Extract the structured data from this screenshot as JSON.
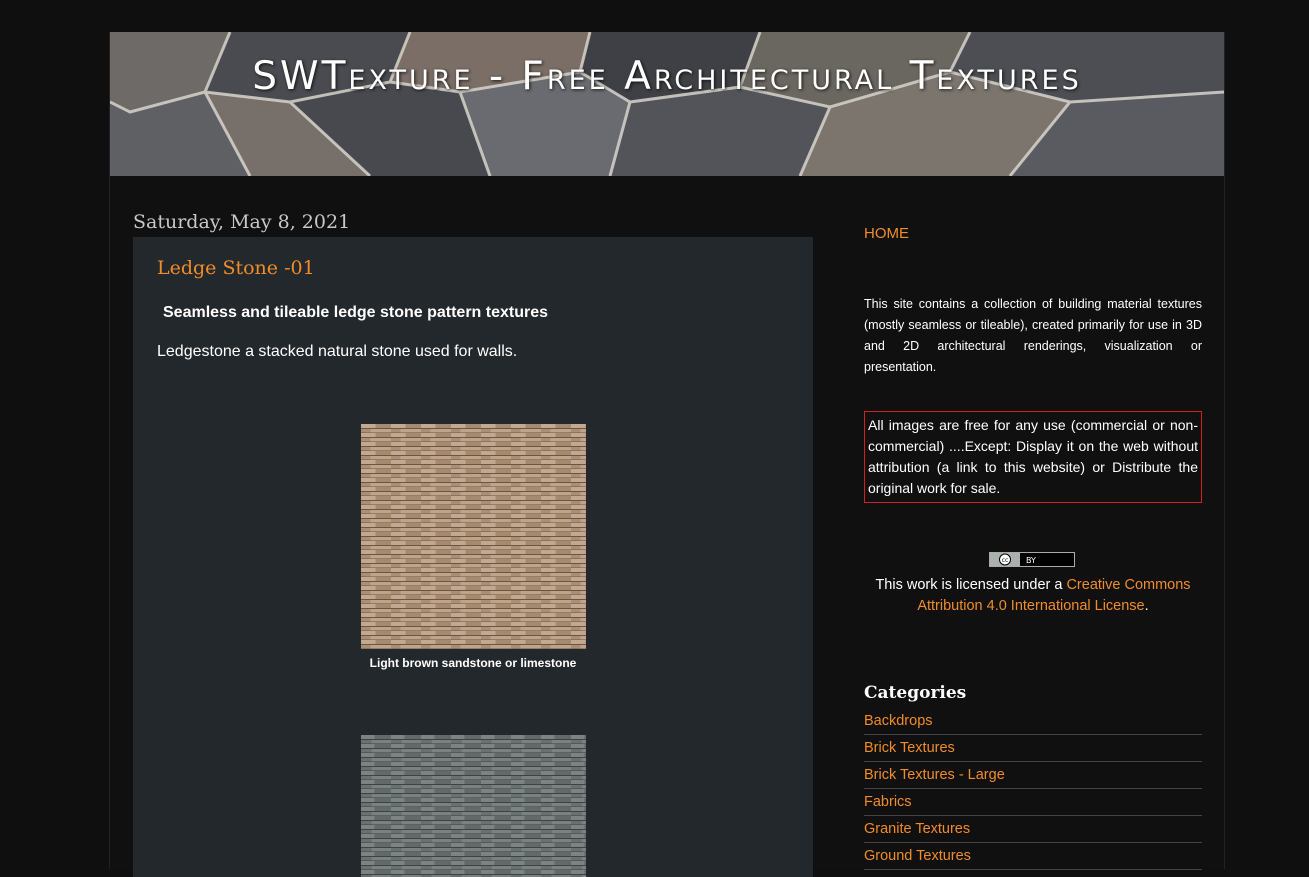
{
  "header": {
    "title": "SWTexture - Free Architectural Textures"
  },
  "post": {
    "date": "Saturday, May 8, 2021",
    "title": "Ledge Stone -01",
    "subheading": "Seamless and tileable ledge stone pattern textures",
    "intro": "Ledgestone a stacked natural stone used for walls.",
    "images": [
      {
        "caption": "Light brown sandstone or  limestone",
        "color": "#b59a80"
      },
      {
        "caption": "",
        "color": "#6e7574"
      }
    ]
  },
  "sidebar": {
    "home_label": "HOME",
    "about": "This site contains a collection of building material textures (mostly seamless or tileable), created primarily for use in 3D and 2D architectural renderings, visualization or presentation.",
    "notice": "All images are free for any use (commercial or non-commercial) ....Except: Display it on the web without attribution (a link to this website) or Distribute the original work for sale.",
    "license_prefix": "This work is licensed under a ",
    "license_link": "Creative Commons Attribution 4.0 International License",
    "license_suffix": ".",
    "categories_title": "Categories",
    "categories": [
      "Backdrops",
      "Brick Textures",
      "Brick Textures - Large",
      "Fabrics",
      "Granite Textures",
      "Ground Textures"
    ]
  },
  "colors": {
    "accent": "#f08c2a",
    "post_background": "#23282d",
    "notice_border": "#cc2222"
  }
}
